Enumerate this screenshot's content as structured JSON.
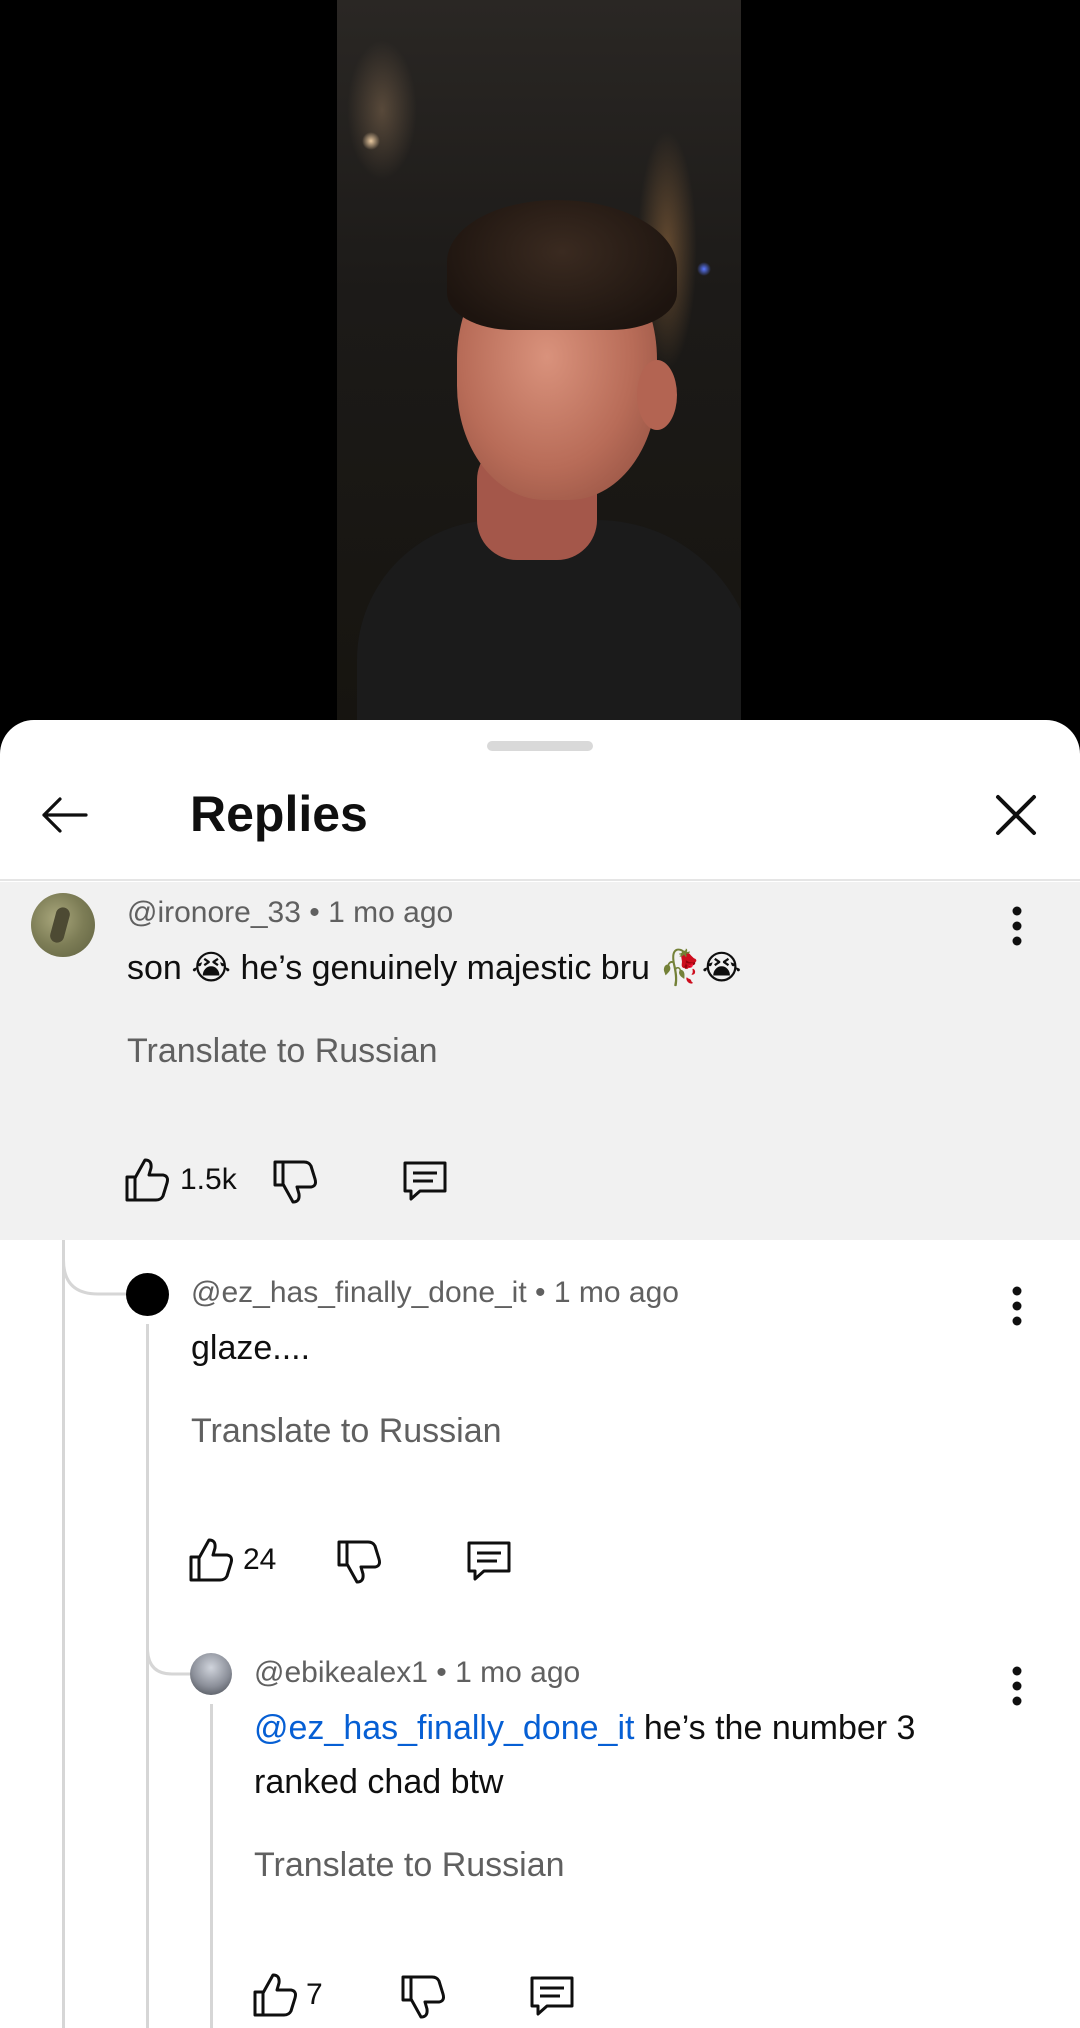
{
  "header": {
    "title": "Replies"
  },
  "comments": [
    {
      "author": "@ironore_33",
      "time": "1 mo ago",
      "text": "son 😭 he’s genuinely majestic bru 🥀😭",
      "translate": "Translate to Russian",
      "likes": "1.5k"
    },
    {
      "author": "@ez_has_finally_done_it",
      "time": "1 mo ago",
      "text": "glaze....",
      "translate": "Translate to Russian",
      "likes": "24"
    },
    {
      "author": "@ebikealex1",
      "time": "1 mo ago",
      "mention": "@ez_has_finally_done_it",
      "text": " he’s the number 3 ranked chad btw",
      "translate": "Translate to Russian",
      "likes": "7"
    }
  ],
  "separator": "•",
  "colors": {
    "link": "#065fd4",
    "highlight_bg": "#f1f1f1",
    "meta": "#606060"
  },
  "icons": [
    "back-arrow-icon",
    "close-icon",
    "like-icon",
    "dislike-icon",
    "reply-icon",
    "more-vert-icon"
  ]
}
